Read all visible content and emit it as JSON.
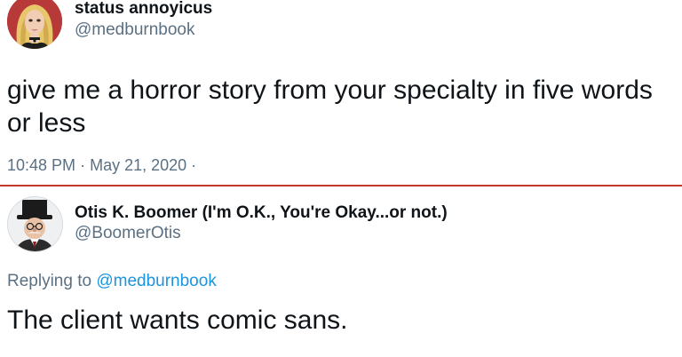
{
  "tweet": {
    "author": {
      "display_name": "status annoyicus",
      "handle": "@medburnbook"
    },
    "text": "give me a horror story from your specialty in five words or less",
    "time": "10:48 PM",
    "separator": "·",
    "date": "May 21, 2020",
    "trailing_separator": "·"
  },
  "reply": {
    "author": {
      "display_name": "Otis K. Boomer (I'm O.K., You're Okay...or not.)",
      "handle": "@BoomerOtis"
    },
    "replying_label": "Replying to",
    "replying_to": "@medburnbook",
    "text": "The client wants comic sans."
  },
  "colors": {
    "divider": "#c0392b",
    "link": "#1b95e0",
    "secondary_text": "#5b7083",
    "primary_text": "#0f1419"
  }
}
